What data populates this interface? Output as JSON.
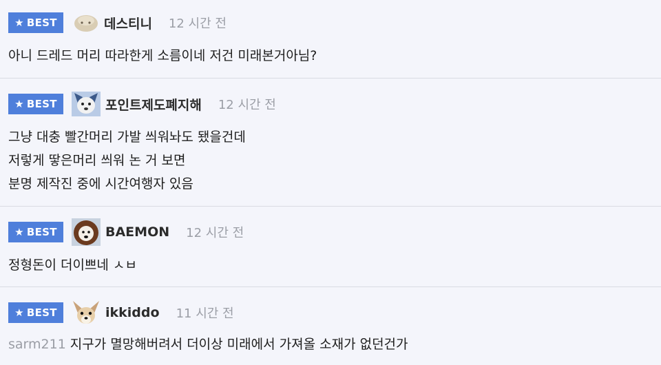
{
  "badge_label": "BEST",
  "colors": {
    "badge": "#4f7fdb",
    "time": "#9b9ea6",
    "divider": "#d9dbe2",
    "background": "#f4f5fb"
  },
  "comments": [
    {
      "avatar_icon": "blob-avatar-icon",
      "nickname": "데스티니",
      "time": "12 시간 전",
      "lines": [
        "아니 드레드 머리 따라한게 소름이네 저건 미래본거아님?"
      ]
    },
    {
      "avatar_icon": "dog-avatar-icon",
      "nickname": "포인트제도폐지해",
      "time": "12 시간 전",
      "lines": [
        "그냥 대충 빨간머리 가발 씌워놔도 됐을건데",
        "저렇게 땋은머리 씌워 논 거 보면",
        "분명 제작진 중에 시간여행자 있음"
      ]
    },
    {
      "avatar_icon": "lion-avatar-icon",
      "nickname": "BAEMON",
      "time": "12 시간 전",
      "lines": [
        "정형돈이 더이쁘네 ㅅㅂ"
      ]
    },
    {
      "avatar_icon": "chihuahua-avatar-icon",
      "nickname": "ikkiddo",
      "time": "11 시간 전",
      "mention": "sarm211",
      "lines": [
        "지구가 멸망해버려서 더이상 미래에서 가져올 소재가 없던건가"
      ]
    }
  ]
}
